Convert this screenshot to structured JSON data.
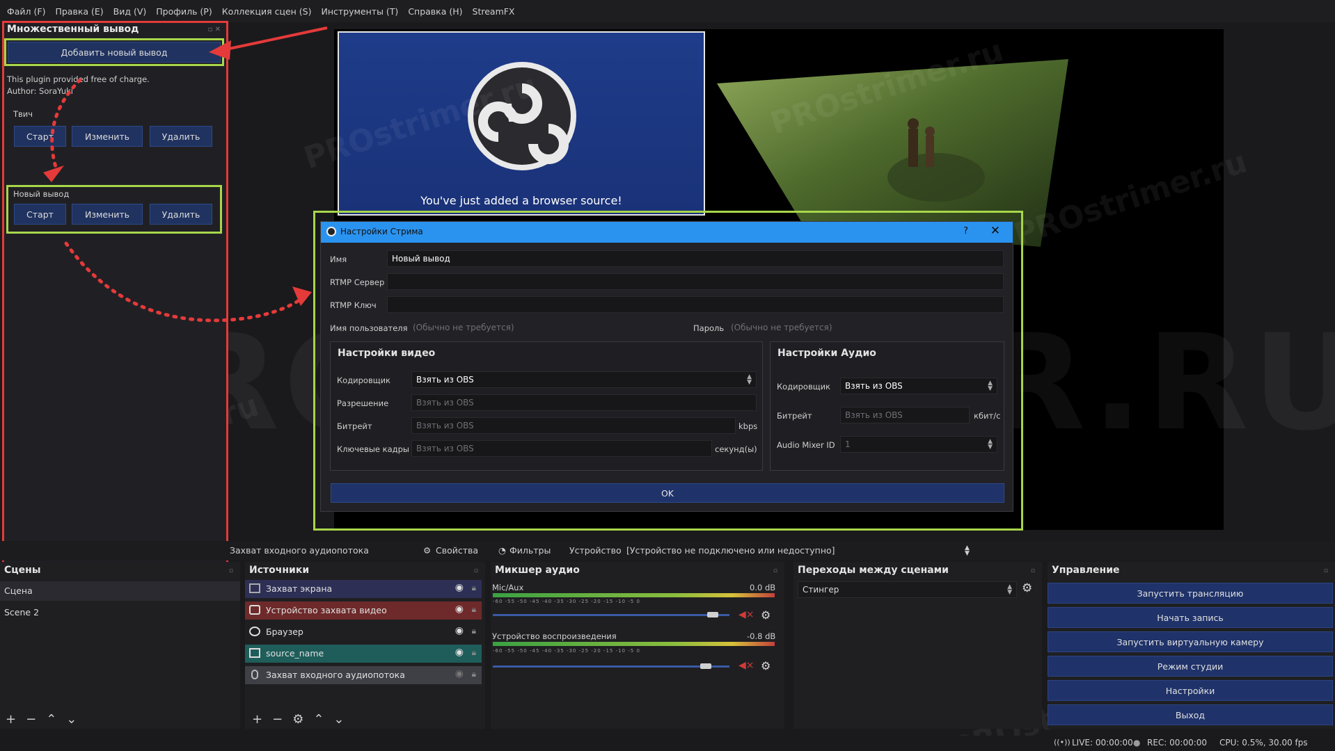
{
  "menu": [
    "Файл (F)",
    "Правка (E)",
    "Вид (V)",
    "Профиль (P)",
    "Коллекция сцен (S)",
    "Инструменты (T)",
    "Справка (H)",
    "StreamFX"
  ],
  "plugin_dock": {
    "title": "Множественный вывод",
    "add_output_label": "Добавить новый вывод",
    "note_line1": "This plugin provided free of charge.",
    "note_line2": "Author: SoraYuki",
    "outputs": [
      {
        "name": "Твич",
        "start": "Старт",
        "edit": "Изменить",
        "delete": "Удалить"
      },
      {
        "name": "Новый вывод",
        "start": "Старт",
        "edit": "Изменить",
        "delete": "Удалить"
      }
    ]
  },
  "preview": {
    "browser_caption": "You've just added a browser source!"
  },
  "watermark": {
    "big": "PROSTRIMER.RU",
    "small": "PROstrimer.ru"
  },
  "dialog": {
    "title": "Настройки Стрима",
    "help": "?",
    "close": "✕",
    "name_label": "Имя",
    "name_value": "Новый вывод",
    "rtmp_server_label": "RTMP Сервер",
    "rtmp_key_label": "RTMP Ключ",
    "username_label": "Имя пользователя",
    "username_placeholder": "(Обычно не требуется)",
    "password_label": "Пароль",
    "password_placeholder": "(Обычно не требуется)",
    "video": {
      "title": "Настройки видео",
      "encoder_label": "Кодировщик",
      "encoder_value": "Взять из OBS",
      "resolution_label": "Разрешение",
      "resolution_placeholder": "Взять из OBS",
      "bitrate_label": "Битрейт",
      "bitrate_placeholder": "Взять из OBS",
      "bitrate_unit": "kbps",
      "keyframes_label": "Ключевые кадры",
      "keyframes_placeholder": "Взять из OBS",
      "keyframes_unit": "секунд(ы)"
    },
    "audio": {
      "title": "Настройки Аудио",
      "encoder_label": "Кодировщик",
      "encoder_value": "Взять из OBS",
      "bitrate_label": "Битрейт",
      "bitrate_placeholder": "Взять из OBS",
      "bitrate_unit": "кбит/с",
      "mixer_label": "Audio Mixer ID",
      "mixer_value": "1"
    },
    "ok_label": "OK"
  },
  "source_bar": {
    "selected": "Захват входного аудиопотока",
    "properties": "Свойства",
    "filters": "Фильтры",
    "device_label": "Устройство",
    "device_value": "[Устройство не подключено или недоступно]"
  },
  "scenes": {
    "title": "Сцены",
    "items": [
      "Сцена",
      "Scene 2"
    ]
  },
  "sources": {
    "title": "Источники",
    "items": [
      {
        "label": "Захват экрана",
        "bg": "#2d2f55"
      },
      {
        "label": "Устройство захвата видео",
        "bg": "#6e2a2a"
      },
      {
        "label": "Браузер",
        "bg": "#1f1f22"
      },
      {
        "label": "source_name",
        "bg": "#1e5d5a"
      },
      {
        "label": "Захват входного аудиопотока",
        "bg": "#3f3f46"
      }
    ]
  },
  "mixer": {
    "title": "Микшер аудио",
    "channels": [
      {
        "name": "Mic/Aux",
        "db": "0.0 dB",
        "level": 0.93
      },
      {
        "name": "Устройство воспроизведения",
        "db": "-0.8 dB",
        "level": 0.9
      }
    ],
    "ticks": "-60 -55 -50 -45 -40 -35 -30 -25 -20 -15 -10 -5 0"
  },
  "transitions": {
    "title": "Переходы между сценами",
    "selected": "Стингер"
  },
  "controls": {
    "title": "Управление",
    "buttons": [
      "Запустить трансляцию",
      "Начать запись",
      "Запустить виртуальную камеру",
      "Режим студии",
      "Настройки",
      "Выход"
    ]
  },
  "status": {
    "live": "LIVE: 00:00:00",
    "rec": "REC: 00:00:00",
    "cpu": "CPU: 0.5%, 30.00 fps"
  },
  "colors": {
    "annotation_red": "#e53a3a",
    "annotation_green": "#a8d64a",
    "dialog_titlebar": "#2a93f0",
    "button_blue": "#20325f"
  }
}
